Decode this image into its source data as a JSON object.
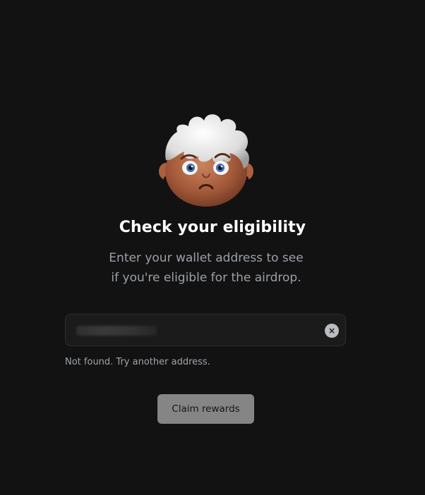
{
  "header": {
    "title": "Check your eligibility",
    "subtitle_line1": "Enter your wallet address to see",
    "subtitle_line2": "if you're eligible for the airdrop."
  },
  "avatar": {
    "icon": "worried-character-avatar-icon",
    "mood": "worried"
  },
  "wallet_input": {
    "value": "",
    "value_obscured": true,
    "clear_icon": "close-icon",
    "clear_glyph": "×"
  },
  "status": {
    "message": "Not found. Try another address."
  },
  "actions": {
    "claim_label": "Claim rewards"
  },
  "colors": {
    "background": "#121212",
    "input_background": "#1b1b1b",
    "button_background": "#858585",
    "muted_text": "#9ea3ab"
  }
}
